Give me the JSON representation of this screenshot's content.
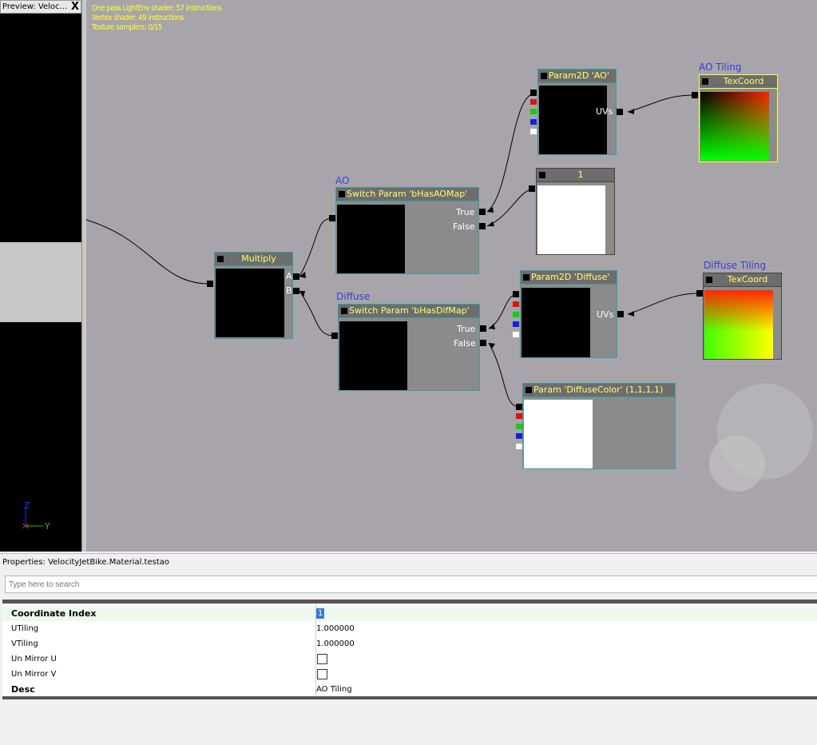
{
  "preview": {
    "tab_title": "Preview: Veloc...",
    "close_glyph": "X",
    "axis_z": "Z",
    "axis_y": "Y",
    "axis_x": "X"
  },
  "stats": [
    "One pass LightEnv shader: 57 instructions",
    "Vertex shader: 49 instructions",
    "Texture samplers: 0/15"
  ],
  "nodes": {
    "multiply": {
      "title": "Multiply",
      "ports": [
        "A",
        "B"
      ]
    },
    "switch_ao": {
      "label": "AO",
      "title": "Switch Param 'bHasAOMap'",
      "ports": [
        "True",
        "False"
      ]
    },
    "switch_dif": {
      "label": "Diffuse",
      "title": "Switch Param 'bHasDifMap'",
      "ports": [
        "True",
        "False"
      ]
    },
    "param_ao": {
      "title": "Param2D 'AO'",
      "port": "UVs"
    },
    "const_one": {
      "title": "1"
    },
    "param_diffuse": {
      "title": "Param2D 'Diffuse'",
      "port": "UVs"
    },
    "param_color": {
      "title": "Param 'DiffuseColor' (1,1,1,1)"
    },
    "tex_ao": {
      "label": "AO Tiling",
      "title": "TexCoord"
    },
    "tex_dif": {
      "label": "Diffuse Tiling",
      "title": "TexCoord"
    }
  },
  "properties": {
    "title": "Properties: VelocityJetBike.Material.testao",
    "search_placeholder": "Type here to search",
    "rows": [
      {
        "key": "Coordinate Index",
        "value": "1"
      },
      {
        "key": "UTiling",
        "value": "1.000000"
      },
      {
        "key": "VTiling",
        "value": "1.000000"
      },
      {
        "key": "Un Mirror U",
        "checked": false
      },
      {
        "key": "Un Mirror V",
        "checked": false
      },
      {
        "key": "Desc",
        "value": "AO Tiling"
      }
    ]
  },
  "colors": {
    "canvas": "#a7a5a9",
    "node_border": "#3c9ca0",
    "node_title": "#ffff70",
    "selected_border": "#ffff40",
    "label": "#3c3cd6"
  }
}
